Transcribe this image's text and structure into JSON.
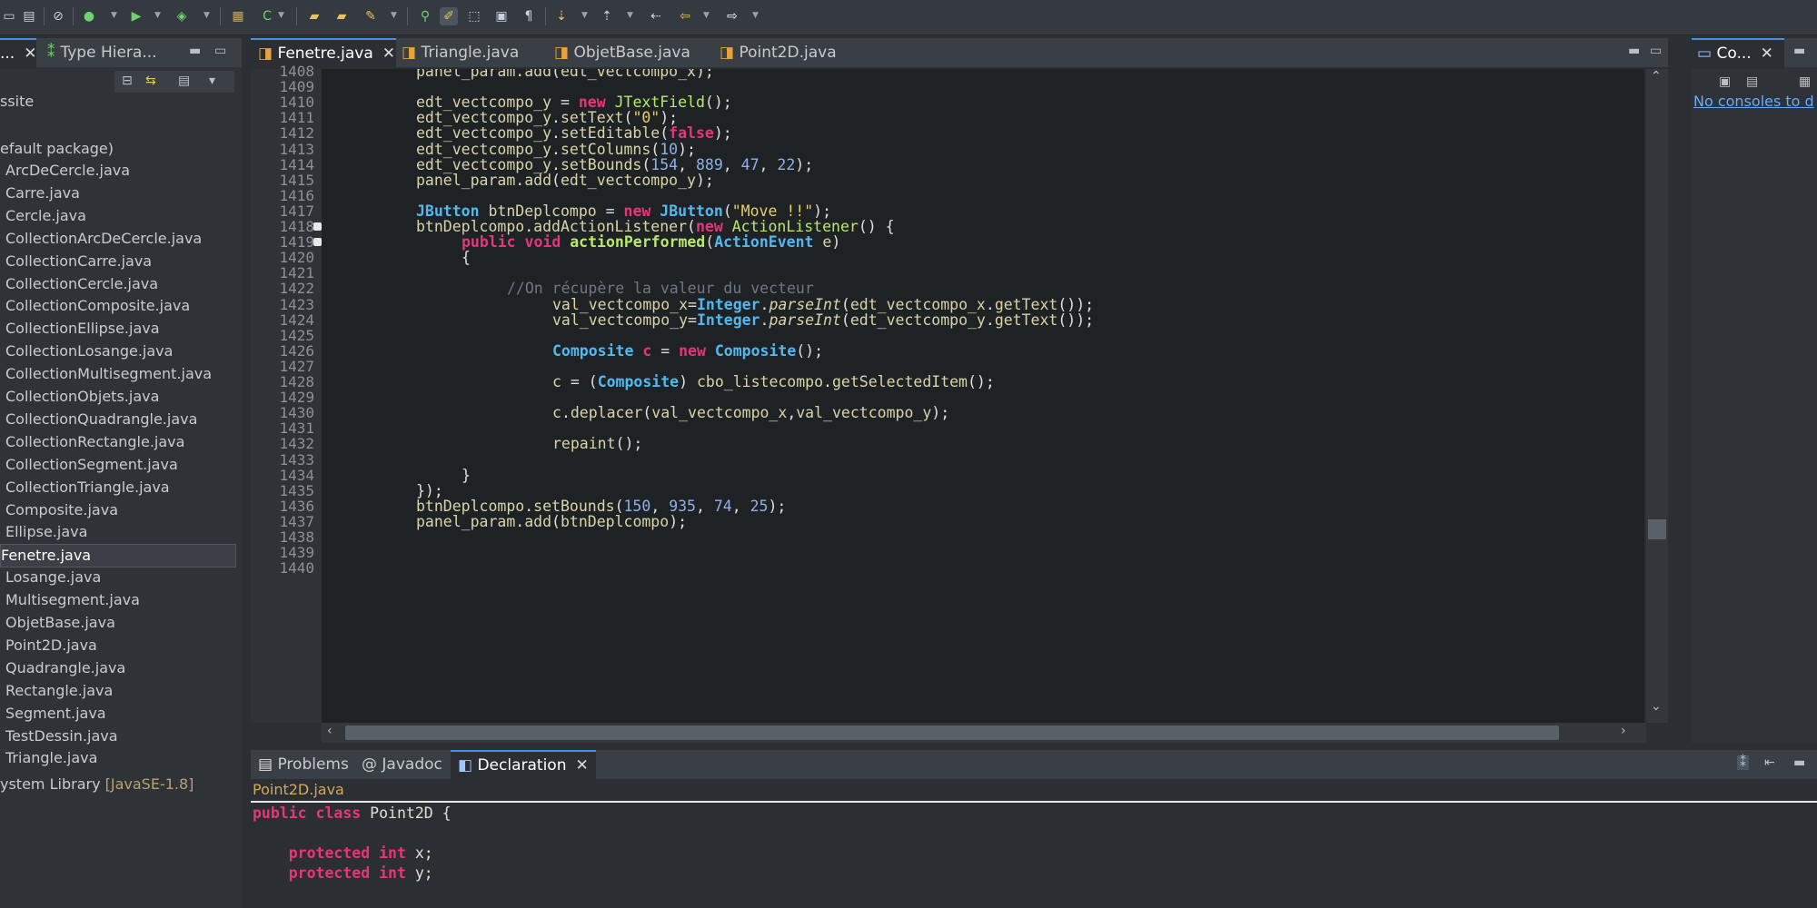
{
  "toolbar": {
    "icons": [
      "save-all-icon",
      "print-icon",
      "history-icon",
      "run-icon",
      "run-dropdown-icon",
      "debug-icon",
      "coverage-icon",
      "new-class-icon",
      "new-package-icon",
      "open-folder-icon",
      "open-type-icon",
      "edit-icon",
      "search-icon",
      "highlight-icon",
      "toggle-mark-icon",
      "breadcrumb-icon",
      "block-select-icon",
      "next-annotation-icon",
      "prev-annotation-icon",
      "back-icon",
      "forward-icon"
    ]
  },
  "explorer": {
    "tabs": [
      {
        "label": "..."
      },
      {
        "label": "Type Hiera..."
      }
    ],
    "project": "ssite",
    "package": "efault package)",
    "files": [
      "ArcDeCercle.java",
      "Carre.java",
      "Cercle.java",
      "CollectionArcDeCercle.java",
      "CollectionCarre.java",
      "CollectionCercle.java",
      "CollectionComposite.java",
      "CollectionEllipse.java",
      "CollectionLosange.java",
      "CollectionMultisegment.java",
      "CollectionObjets.java",
      "CollectionQuadrangle.java",
      "CollectionRectangle.java",
      "CollectionSegment.java",
      "CollectionTriangle.java",
      "Composite.java",
      "Ellipse.java",
      "Fenetre.java",
      "Losange.java",
      "Multisegment.java",
      "ObjetBase.java",
      "Point2D.java",
      "Quadrangle.java",
      "Rectangle.java",
      "Segment.java",
      "TestDessin.java",
      "Triangle.java"
    ],
    "selected": "Fenetre.java",
    "library_label": "ystem Library",
    "library_version": "[JavaSE-1.8]"
  },
  "editor": {
    "tabs": [
      {
        "label": "Fenetre.java",
        "active": true
      },
      {
        "label": "Triangle.java",
        "active": false
      },
      {
        "label": "ObjetBase.java",
        "active": false
      },
      {
        "label": "Point2D.java",
        "active": false
      }
    ],
    "line_numbers": [
      "1408",
      "1409",
      "1410",
      "1411",
      "1412",
      "1413",
      "1414",
      "1415",
      "1416",
      "1417",
      "1418",
      "1419",
      "1420",
      "1421",
      "1422",
      "1423",
      "1424",
      "1425",
      "1426",
      "1427",
      "1428",
      "1429",
      "1430",
      "1431",
      "1432",
      "1433",
      "1434",
      "1435",
      "1436",
      "1437",
      "1438",
      "1439",
      "1440"
    ],
    "lines": [
      "panel_param.add(edt_vectcompo_x);",
      "",
      "edt_vectcompo_y = new JTextField();",
      "edt_vectcompo_y.setText(\"0\");",
      "edt_vectcompo_y.setEditable(false);",
      "edt_vectcompo_y.setColumns(10);",
      "edt_vectcompo_y.setBounds(154, 889, 47, 22);",
      "panel_param.add(edt_vectcompo_y);",
      "",
      "JButton btnDeplcompo = new JButton(\"Move !!\");",
      "btnDeplcompo.addActionListener(new ActionListener() {",
      "public void actionPerformed(ActionEvent e)",
      "{",
      "",
      "//On récupère la valeur du vecteur",
      "val_vectcompo_x=Integer.parseInt(edt_vectcompo_x.getText());",
      "val_vectcompo_y=Integer.parseInt(edt_vectcompo_y.getText());",
      "",
      "Composite c = new Composite();",
      "",
      "c = (Composite) cbo_listecompo.getSelectedItem();",
      "",
      "c.deplacer(val_vectcompo_x,val_vectcompo_y);",
      "",
      "repaint();",
      "",
      "}",
      "});",
      "btnDeplcompo.setBounds(150, 935, 74, 25);",
      "panel_param.add(btnDeplcompo);",
      "",
      "",
      ""
    ]
  },
  "console": {
    "tab_label": "Co...",
    "message": "No consoles to d"
  },
  "bottom": {
    "tabs": [
      {
        "label": "Problems",
        "active": false
      },
      {
        "label": "Javadoc",
        "active": false
      },
      {
        "label": "Declaration",
        "active": true
      }
    ],
    "file_link": "Point2D.java",
    "decl_lines": [
      "public class Point2D {",
      "",
      "    protected int x;",
      "    protected int y;"
    ]
  },
  "colors": {
    "keyword": "#e8347a",
    "type": "#52b8f0",
    "string": "#e9cf6a",
    "number": "#8fb0e8",
    "comment": "#6f7780",
    "accent": "#4a90d9"
  }
}
